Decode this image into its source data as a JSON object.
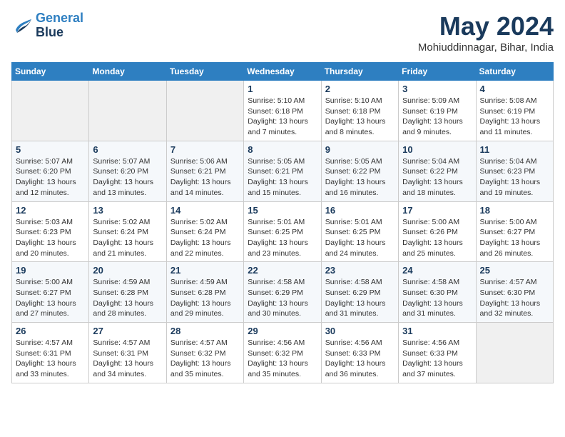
{
  "logo": {
    "line1": "General",
    "line2": "Blue"
  },
  "title": "May 2024",
  "location": "Mohiuddinnagar, Bihar, India",
  "weekdays": [
    "Sunday",
    "Monday",
    "Tuesday",
    "Wednesday",
    "Thursday",
    "Friday",
    "Saturday"
  ],
  "weeks": [
    [
      {
        "day": "",
        "info": ""
      },
      {
        "day": "",
        "info": ""
      },
      {
        "day": "",
        "info": ""
      },
      {
        "day": "1",
        "info": "Sunrise: 5:10 AM\nSunset: 6:18 PM\nDaylight: 13 hours\nand 7 minutes."
      },
      {
        "day": "2",
        "info": "Sunrise: 5:10 AM\nSunset: 6:18 PM\nDaylight: 13 hours\nand 8 minutes."
      },
      {
        "day": "3",
        "info": "Sunrise: 5:09 AM\nSunset: 6:19 PM\nDaylight: 13 hours\nand 9 minutes."
      },
      {
        "day": "4",
        "info": "Sunrise: 5:08 AM\nSunset: 6:19 PM\nDaylight: 13 hours\nand 11 minutes."
      }
    ],
    [
      {
        "day": "5",
        "info": "Sunrise: 5:07 AM\nSunset: 6:20 PM\nDaylight: 13 hours\nand 12 minutes."
      },
      {
        "day": "6",
        "info": "Sunrise: 5:07 AM\nSunset: 6:20 PM\nDaylight: 13 hours\nand 13 minutes."
      },
      {
        "day": "7",
        "info": "Sunrise: 5:06 AM\nSunset: 6:21 PM\nDaylight: 13 hours\nand 14 minutes."
      },
      {
        "day": "8",
        "info": "Sunrise: 5:05 AM\nSunset: 6:21 PM\nDaylight: 13 hours\nand 15 minutes."
      },
      {
        "day": "9",
        "info": "Sunrise: 5:05 AM\nSunset: 6:22 PM\nDaylight: 13 hours\nand 16 minutes."
      },
      {
        "day": "10",
        "info": "Sunrise: 5:04 AM\nSunset: 6:22 PM\nDaylight: 13 hours\nand 18 minutes."
      },
      {
        "day": "11",
        "info": "Sunrise: 5:04 AM\nSunset: 6:23 PM\nDaylight: 13 hours\nand 19 minutes."
      }
    ],
    [
      {
        "day": "12",
        "info": "Sunrise: 5:03 AM\nSunset: 6:23 PM\nDaylight: 13 hours\nand 20 minutes."
      },
      {
        "day": "13",
        "info": "Sunrise: 5:02 AM\nSunset: 6:24 PM\nDaylight: 13 hours\nand 21 minutes."
      },
      {
        "day": "14",
        "info": "Sunrise: 5:02 AM\nSunset: 6:24 PM\nDaylight: 13 hours\nand 22 minutes."
      },
      {
        "day": "15",
        "info": "Sunrise: 5:01 AM\nSunset: 6:25 PM\nDaylight: 13 hours\nand 23 minutes."
      },
      {
        "day": "16",
        "info": "Sunrise: 5:01 AM\nSunset: 6:25 PM\nDaylight: 13 hours\nand 24 minutes."
      },
      {
        "day": "17",
        "info": "Sunrise: 5:00 AM\nSunset: 6:26 PM\nDaylight: 13 hours\nand 25 minutes."
      },
      {
        "day": "18",
        "info": "Sunrise: 5:00 AM\nSunset: 6:27 PM\nDaylight: 13 hours\nand 26 minutes."
      }
    ],
    [
      {
        "day": "19",
        "info": "Sunrise: 5:00 AM\nSunset: 6:27 PM\nDaylight: 13 hours\nand 27 minutes."
      },
      {
        "day": "20",
        "info": "Sunrise: 4:59 AM\nSunset: 6:28 PM\nDaylight: 13 hours\nand 28 minutes."
      },
      {
        "day": "21",
        "info": "Sunrise: 4:59 AM\nSunset: 6:28 PM\nDaylight: 13 hours\nand 29 minutes."
      },
      {
        "day": "22",
        "info": "Sunrise: 4:58 AM\nSunset: 6:29 PM\nDaylight: 13 hours\nand 30 minutes."
      },
      {
        "day": "23",
        "info": "Sunrise: 4:58 AM\nSunset: 6:29 PM\nDaylight: 13 hours\nand 31 minutes."
      },
      {
        "day": "24",
        "info": "Sunrise: 4:58 AM\nSunset: 6:30 PM\nDaylight: 13 hours\nand 31 minutes."
      },
      {
        "day": "25",
        "info": "Sunrise: 4:57 AM\nSunset: 6:30 PM\nDaylight: 13 hours\nand 32 minutes."
      }
    ],
    [
      {
        "day": "26",
        "info": "Sunrise: 4:57 AM\nSunset: 6:31 PM\nDaylight: 13 hours\nand 33 minutes."
      },
      {
        "day": "27",
        "info": "Sunrise: 4:57 AM\nSunset: 6:31 PM\nDaylight: 13 hours\nand 34 minutes."
      },
      {
        "day": "28",
        "info": "Sunrise: 4:57 AM\nSunset: 6:32 PM\nDaylight: 13 hours\nand 35 minutes."
      },
      {
        "day": "29",
        "info": "Sunrise: 4:56 AM\nSunset: 6:32 PM\nDaylight: 13 hours\nand 35 minutes."
      },
      {
        "day": "30",
        "info": "Sunrise: 4:56 AM\nSunset: 6:33 PM\nDaylight: 13 hours\nand 36 minutes."
      },
      {
        "day": "31",
        "info": "Sunrise: 4:56 AM\nSunset: 6:33 PM\nDaylight: 13 hours\nand 37 minutes."
      },
      {
        "day": "",
        "info": ""
      }
    ]
  ]
}
